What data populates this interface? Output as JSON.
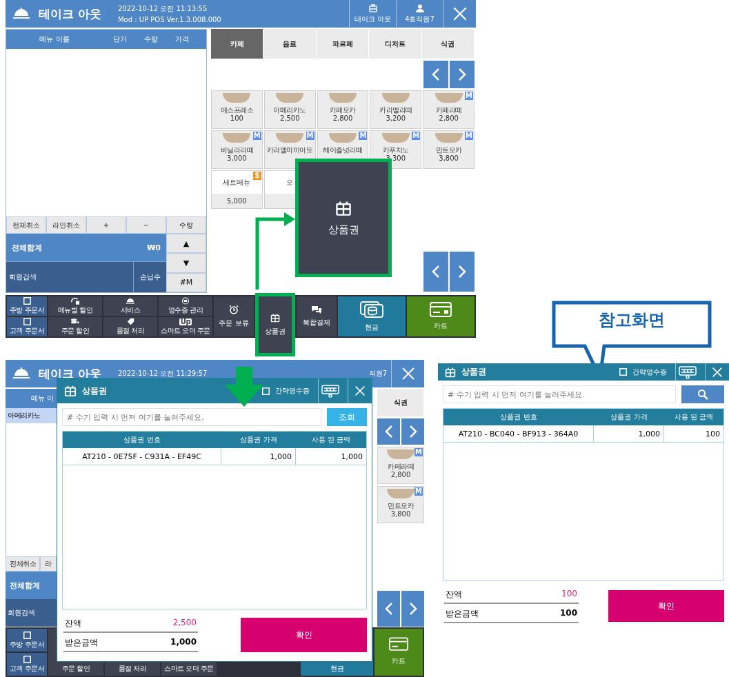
{
  "pos_screen": {
    "header": {
      "title": "테이크 아웃",
      "datetime": "2022-10-12 오전 11:13:55",
      "version": "Mod : UP POS Ver.1.3.008.000",
      "buttons": [
        {
          "label": "테이크 아웃"
        },
        {
          "label": "4호직원7"
        }
      ]
    },
    "order_list": {
      "columns": [
        "메뉴 이름",
        "단가",
        "수량",
        "가격"
      ]
    },
    "order_actions": [
      "전체취소",
      "라인취소",
      "+",
      "−",
      "수량"
    ],
    "total": {
      "label": "전체합계",
      "amount": "₩0"
    },
    "member_search": "회원검색",
    "guest_count": "손님수",
    "side_buttons": [
      "▲",
      "▼",
      "#M"
    ],
    "category_tabs": [
      {
        "label": "카페",
        "selected": true
      },
      {
        "label": "음료",
        "selected": false
      },
      {
        "label": "파르페",
        "selected": false
      },
      {
        "label": "디저트",
        "selected": false
      },
      {
        "label": "식권",
        "selected": false
      }
    ],
    "menu_items": [
      {
        "kind": "photo",
        "name": "에스프레소",
        "price": "100"
      },
      {
        "kind": "photo",
        "name": "아메리카노",
        "price": "2,500"
      },
      {
        "kind": "photo",
        "name": "카페모카",
        "price": "2,800"
      },
      {
        "kind": "photo",
        "name": "카라멜라떼",
        "price": "3,200"
      },
      {
        "kind": "photo",
        "name": "카페라떼",
        "price": "2,800",
        "badge": {
          "label": "M",
          "color": "#5b8def"
        }
      },
      {
        "kind": "photo",
        "name": "바닐라라떼",
        "price": "3,000",
        "badge": {
          "label": "M",
          "color": "#5b8def"
        }
      },
      {
        "kind": "photo",
        "name": "카라멜마끼아또",
        "badge": {
          "label": "M",
          "color": "#5b8def"
        }
      },
      {
        "kind": "photo",
        "name": "헤이즐넛라떼",
        "badge": {
          "label": "M",
          "color": "#5b8def"
        }
      },
      {
        "kind": "photo",
        "name": "카푸치노",
        "price": "3,300",
        "badge": {
          "label": "M",
          "color": "#5b8def"
        }
      },
      {
        "kind": "photo",
        "name": "민트모카",
        "price": "3,800",
        "badge": {
          "label": "M",
          "color": "#5b8def"
        }
      },
      {
        "kind": "text",
        "name": "세트메뉴",
        "price": "5,000",
        "badge": {
          "label": "S",
          "color": "#f7931e"
        }
      },
      {
        "kind": "text",
        "name": "오"
      }
    ],
    "bottom_bar": {
      "toggles": [
        {
          "label": "주방 주문서",
          "checked": false
        },
        {
          "label": "고객 주문서",
          "checked": false
        }
      ],
      "tools": [
        {
          "label": "메뉴별 할인"
        },
        {
          "label": "주문 할인"
        },
        {
          "label": "서비스"
        },
        {
          "label": "품절 처리"
        },
        {
          "label": "영수증 관리"
        },
        {
          "label": "스마트 오더 주문",
          "icon_text": "Up"
        }
      ],
      "large": [
        {
          "label": "주문 보류",
          "highlighted": false
        },
        {
          "label": "상품권",
          "highlighted": true
        },
        {
          "label": "복합결제",
          "highlighted": false
        }
      ],
      "payments": [
        {
          "label": "현금",
          "kind": "cash"
        },
        {
          "label": "카드",
          "kind": "card"
        }
      ]
    }
  },
  "zoom_callout": {
    "label": "상품권"
  },
  "second_screen": {
    "header": {
      "title": "테이크 아웃",
      "datetime": "2022-10-12 오전 11:29:57",
      "staff": "직원7"
    },
    "order_list": {
      "column": "메뉴 이",
      "rows": [
        {
          "name": "아메리카노",
          "selected": true
        }
      ]
    },
    "order_actions": [
      "전체취소",
      "라"
    ],
    "total_label": "전체합계",
    "member_search": "회원검색",
    "category_tab": "식권",
    "menu_items": [
      {
        "name": "카페라떼",
        "price": "2,800",
        "badge": {
          "label": "M",
          "color": "#5b8def"
        }
      },
      {
        "name": "민트모카",
        "price": "3,800",
        "badge": {
          "label": "M",
          "color": "#5b8def"
        }
      }
    ],
    "bottom_bar": {
      "toggles": [
        {
          "label": "주방 주문서",
          "checked": false
        },
        {
          "label": "고객 주문서",
          "checked": false
        }
      ],
      "tools": [
        "주문 할인",
        "품절 처리",
        "스마트 오더 주문"
      ],
      "payments": [
        {
          "label": "현금",
          "kind": "cash"
        },
        {
          "label": "카드",
          "kind": "card"
        }
      ]
    }
  },
  "gift_dialog": {
    "title": "상품권",
    "receipt_option": {
      "label": "간략영수증",
      "checked": false
    },
    "search": {
      "placeholder": "# 수기 입력 시 먼저 여기를 눌러주세요.",
      "button": {
        "kind": "text",
        "label": "조회"
      }
    },
    "columns": [
      "상품권 번호",
      "상품권 가격",
      "사용 된 금액"
    ],
    "rows": [
      [
        "AT210 - 0E75F - C931A - EF49C",
        "1,000",
        "1,000"
      ]
    ],
    "balance": {
      "label": "잔액",
      "value": "2,500"
    },
    "received": {
      "label": "받은금액",
      "value": "1,000"
    },
    "confirm": "확인"
  },
  "reference_callout": "참고화면",
  "reference_dialog": {
    "title": "상품권",
    "receipt_option": {
      "label": "간략영수증",
      "checked": false
    },
    "search": {
      "placeholder": "# 수기 입력 시 먼저 여기를 눌러주세요.",
      "button": {
        "kind": "icon"
      }
    },
    "columns": [
      "상품권 번호",
      "상품권 가격",
      "사용 된 금액"
    ],
    "rows": [
      [
        "AT210 - BC040 - BF913 - 364A0",
        "1,000",
        "100"
      ]
    ],
    "balance": {
      "label": "잔액",
      "value": "100"
    },
    "received": {
      "label": "받은금액",
      "value": "100"
    },
    "confirm": "확인"
  }
}
